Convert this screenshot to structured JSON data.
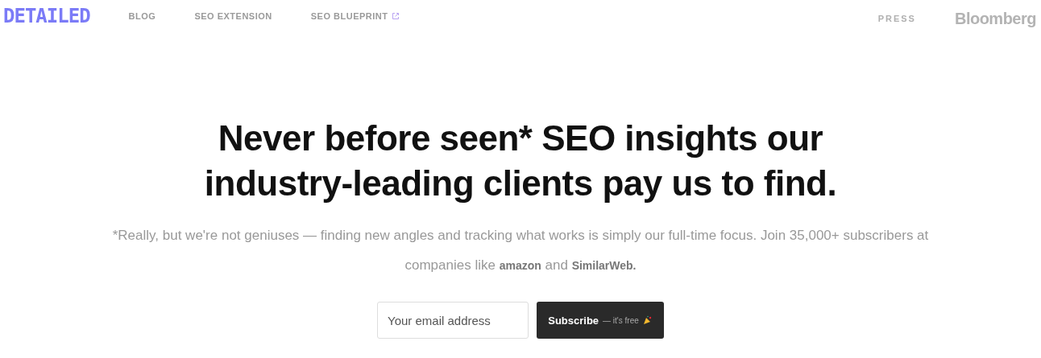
{
  "header": {
    "logo": "DETAILED",
    "nav": [
      {
        "label": "BLOG",
        "external": false
      },
      {
        "label": "SEO EXTENSION",
        "external": false
      },
      {
        "label": "SEO BLUEPRINT",
        "external": true
      }
    ],
    "press_label": "PRESS",
    "press_logo": "Bloomberg"
  },
  "hero": {
    "title_lines": [
      "Never before seen* SEO insights our",
      "industry-leading clients pay us to find."
    ],
    "subtitle": "*Really, but we're not geniuses — finding new angles and tracking what works is simply our full-time focus. Join 35,000+ subscribers at companies like",
    "client_logos": [
      "amazon",
      "SimilarWeb."
    ],
    "subtitle_joiner": "and",
    "form": {
      "placeholder": "Your email address",
      "button": "Subscribe",
      "button_note": "— it's free"
    }
  }
}
